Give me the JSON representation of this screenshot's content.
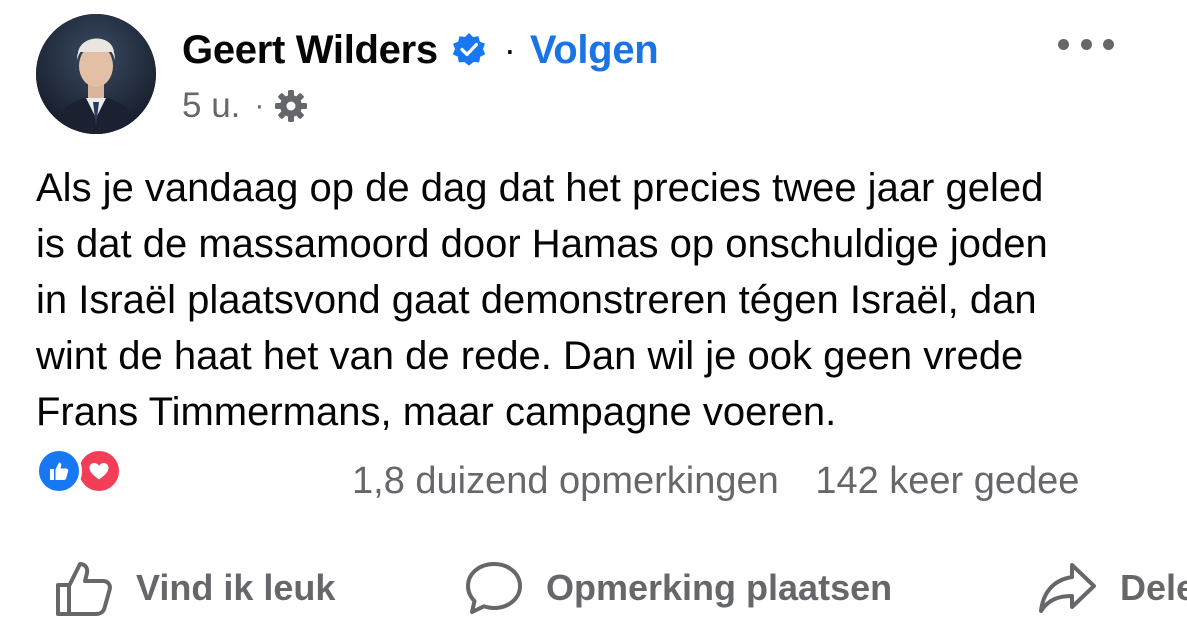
{
  "post": {
    "author": "Geert Wilders",
    "follow_label": "Volgen",
    "separator": "·",
    "time": "5 u.",
    "meta_separator": "·",
    "text_lines": [
      "Als je vandaag op de dag dat het precies twee jaar geled",
      "is dat de massamoord door Hamas op onschuldige joden",
      "in Israël plaatsvond gaat demonstreren tégen Israël, dan",
      "wint de haat het van de rede. Dan wil je ook geen vrede",
      "Frans Timmermans, maar campagne voeren."
    ],
    "comments_count": "1,8 duizend opmerkingen",
    "shares_count": "142 keer gedee"
  },
  "actions": {
    "like_label": "Vind ik leuk",
    "comment_label": "Opmerking plaatsen",
    "share_label": "Dele"
  },
  "icons": {
    "verified": "verified-badge-icon",
    "more": "more-options-icon",
    "audience": "gear-icon",
    "reaction_like": "thumbs-up-icon",
    "reaction_love": "heart-icon",
    "like": "thumbs-up-outline-icon",
    "comment": "comment-bubble-icon",
    "share": "share-arrow-icon"
  },
  "colors": {
    "accent": "#1b74e4",
    "secondary_text": "#65676b",
    "like_reaction": "#1877f2",
    "love_reaction": "#f33e58"
  }
}
